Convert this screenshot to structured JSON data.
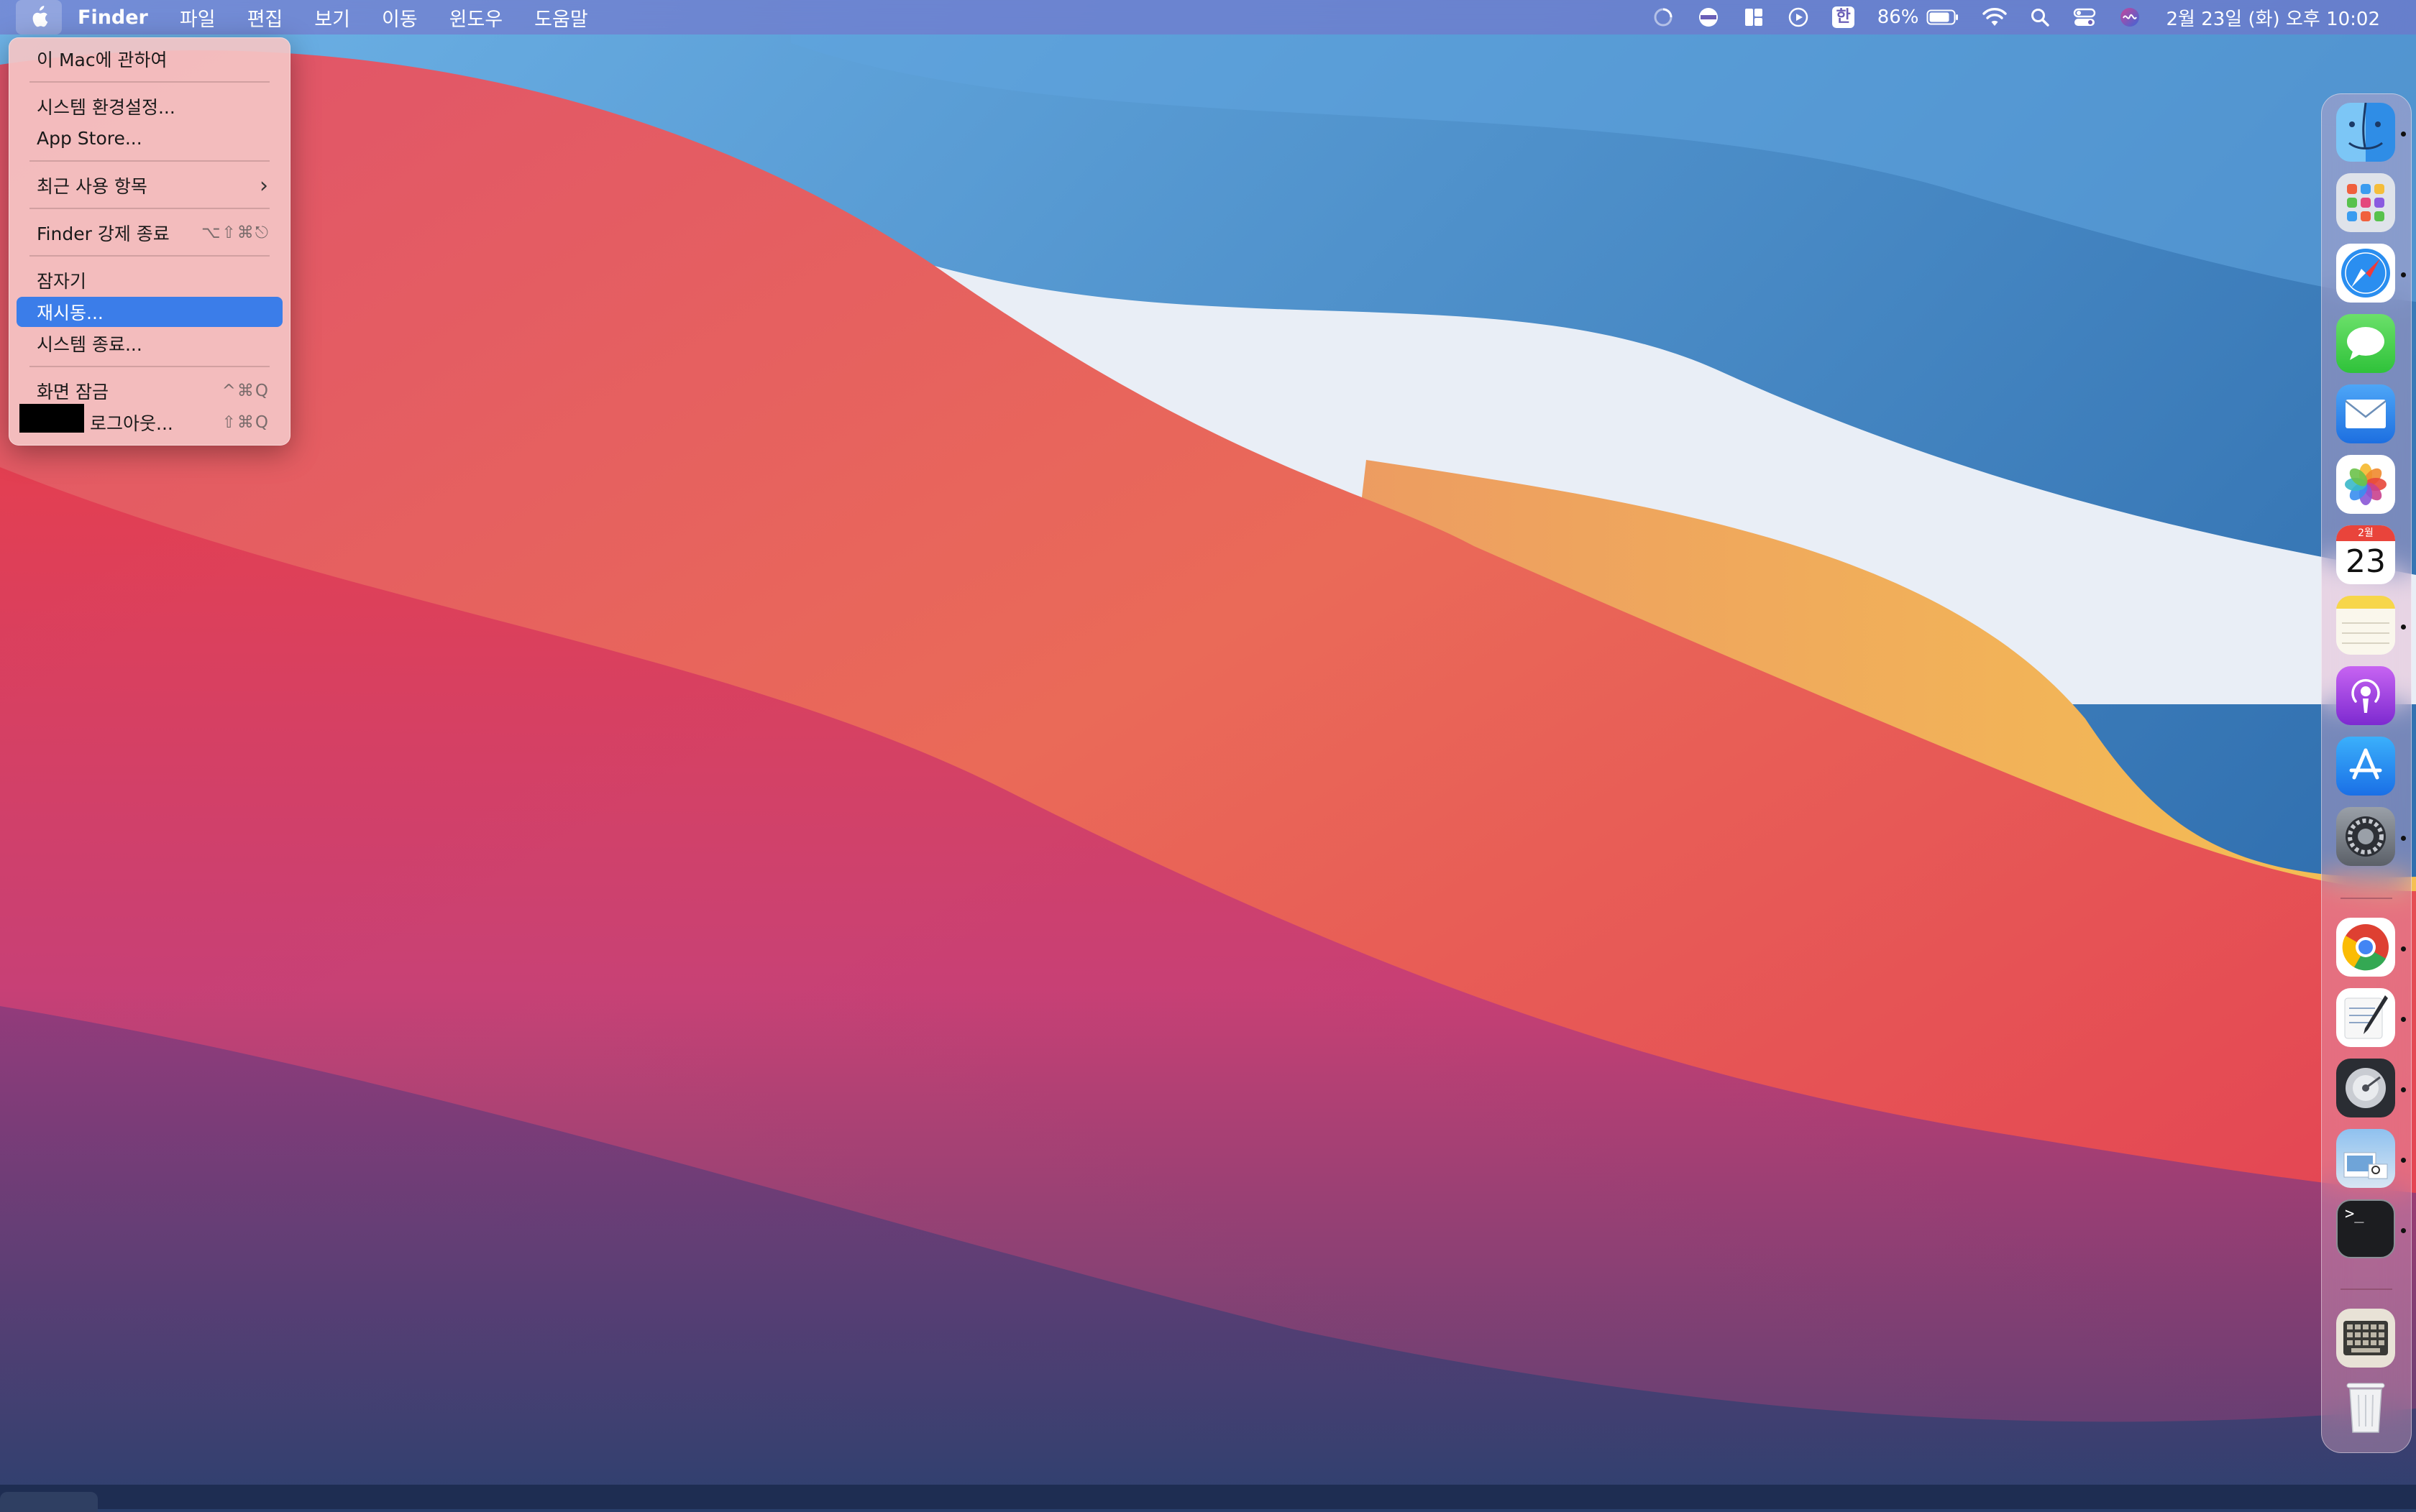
{
  "menubar": {
    "app_name": "Finder",
    "menus": [
      "파일",
      "편집",
      "보기",
      "이동",
      "윈도우",
      "도움말"
    ],
    "battery_percent": "86%",
    "datetime": "2월 23일 (화) 오후 10:02",
    "input_method": "한"
  },
  "apple_menu": {
    "items": [
      {
        "label": "이 Mac에 관하여",
        "shortcut": ""
      },
      {
        "label": "시스템 환경설정...",
        "shortcut": ""
      },
      {
        "label": "App Store...",
        "shortcut": ""
      },
      {
        "label": "최근 사용 항목",
        "shortcut": "›"
      },
      {
        "label": "Finder 강제 종료",
        "shortcut": "⌥⇧⌘⎋"
      },
      {
        "label": "잠자기",
        "shortcut": ""
      },
      {
        "label": "재시동...",
        "shortcut": ""
      },
      {
        "label": "시스템 종료...",
        "shortcut": ""
      },
      {
        "label": "화면 잠금",
        "shortcut": "^⌘Q"
      },
      {
        "label": "로그아웃...",
        "shortcut": "⇧⌘Q"
      }
    ],
    "selected_index": 6
  },
  "dock": {
    "apps": [
      {
        "name": "finder-icon",
        "running": true
      },
      {
        "name": "launchpad-icon",
        "running": false
      },
      {
        "name": "safari-icon",
        "running": true
      },
      {
        "name": "messages-icon",
        "running": false
      },
      {
        "name": "mail-icon",
        "running": false
      },
      {
        "name": "photos-icon",
        "running": false
      },
      {
        "name": "calendar-icon",
        "running": false
      },
      {
        "name": "notes-icon",
        "running": true
      },
      {
        "name": "podcasts-icon",
        "running": false
      },
      {
        "name": "app-store-icon",
        "running": false
      },
      {
        "name": "system-preferences-icon",
        "running": true
      },
      {
        "name": "chrome-icon",
        "running": true
      },
      {
        "name": "textedit-icon",
        "running": true
      },
      {
        "name": "disk-utility-icon",
        "running": true
      },
      {
        "name": "preview-icon",
        "running": true
      },
      {
        "name": "terminal-icon",
        "running": true
      },
      {
        "name": "keyboard-viewer-icon",
        "running": false
      },
      {
        "name": "trash-icon",
        "running": false
      }
    ],
    "calendar_month": "2월",
    "calendar_day": "23"
  },
  "colors": {
    "menu_highlight": "#3b7de9",
    "menubar_tint": "#7b6ec8"
  }
}
